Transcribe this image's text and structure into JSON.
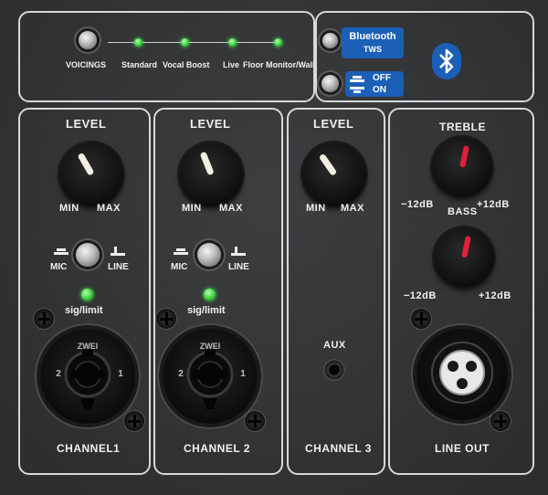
{
  "top": {
    "voicings_label": "VOICINGS",
    "presets": [
      "Standard",
      "Vocal Boost",
      "Live",
      "Floor Monitor/Wall"
    ]
  },
  "bluetooth": {
    "label_line1": "Bluetooth",
    "label_line2": "TWS",
    "off_label": "OFF",
    "on_label": "ON",
    "logo_icon": "bluetooth-icon",
    "accent_color": "#1b5fb6"
  },
  "channel1": {
    "level_label": "LEVEL",
    "min_label": "MIN",
    "max_label": "MAX",
    "mic_label": "MIC",
    "line_label": "LINE",
    "sig_label": "sig/limit",
    "name": "CHANNEL1"
  },
  "channel2": {
    "level_label": "LEVEL",
    "min_label": "MIN",
    "max_label": "MAX",
    "mic_label": "MIC",
    "line_label": "LINE",
    "sig_label": "sig/limit",
    "name": "CHANNEL 2"
  },
  "channel3": {
    "level_label": "LEVEL",
    "min_label": "MIN",
    "max_label": "MAX",
    "aux_label": "AUX",
    "name": "CHANNEL 3"
  },
  "eq": {
    "treble_label": "TREBLE",
    "bass_label": "BASS",
    "treble_min": "−12dB",
    "treble_max": "+12dB",
    "bass_min": "−12dB",
    "bass_max": "+12dB",
    "indicator_color": "#e0203a"
  },
  "output": {
    "name": "LINE OUT"
  }
}
